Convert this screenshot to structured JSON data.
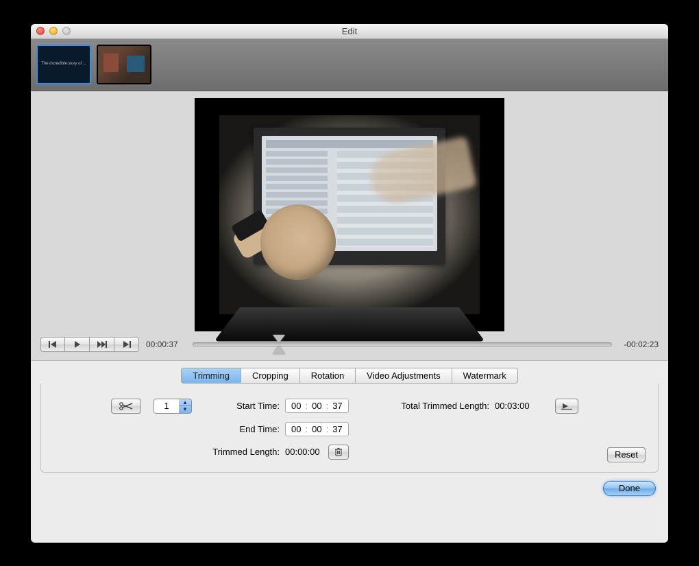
{
  "window": {
    "title": "Edit"
  },
  "thumbs": {
    "item1_text": "The incredible story of ..."
  },
  "transport": {
    "current_time": "00:00:37",
    "remaining_time": "-00:02:23"
  },
  "tabs": {
    "trimming": "Trimming",
    "cropping": "Cropping",
    "rotation": "Rotation",
    "video_adjustments": "Video Adjustments",
    "watermark": "Watermark"
  },
  "trim": {
    "segment_value": "1",
    "start_label": "Start Time:",
    "start": {
      "h": "00",
      "m": "00",
      "s": "37"
    },
    "end_label": "End Time:",
    "end": {
      "h": "00",
      "m": "00",
      "s": "37"
    },
    "trimmed_length_label": "Trimmed Length:",
    "trimmed_length": "00:00:00",
    "total_label": "Total Trimmed Length:",
    "total_value": "00:03:00",
    "reset_label": "Reset"
  },
  "footer": {
    "done_label": "Done"
  }
}
